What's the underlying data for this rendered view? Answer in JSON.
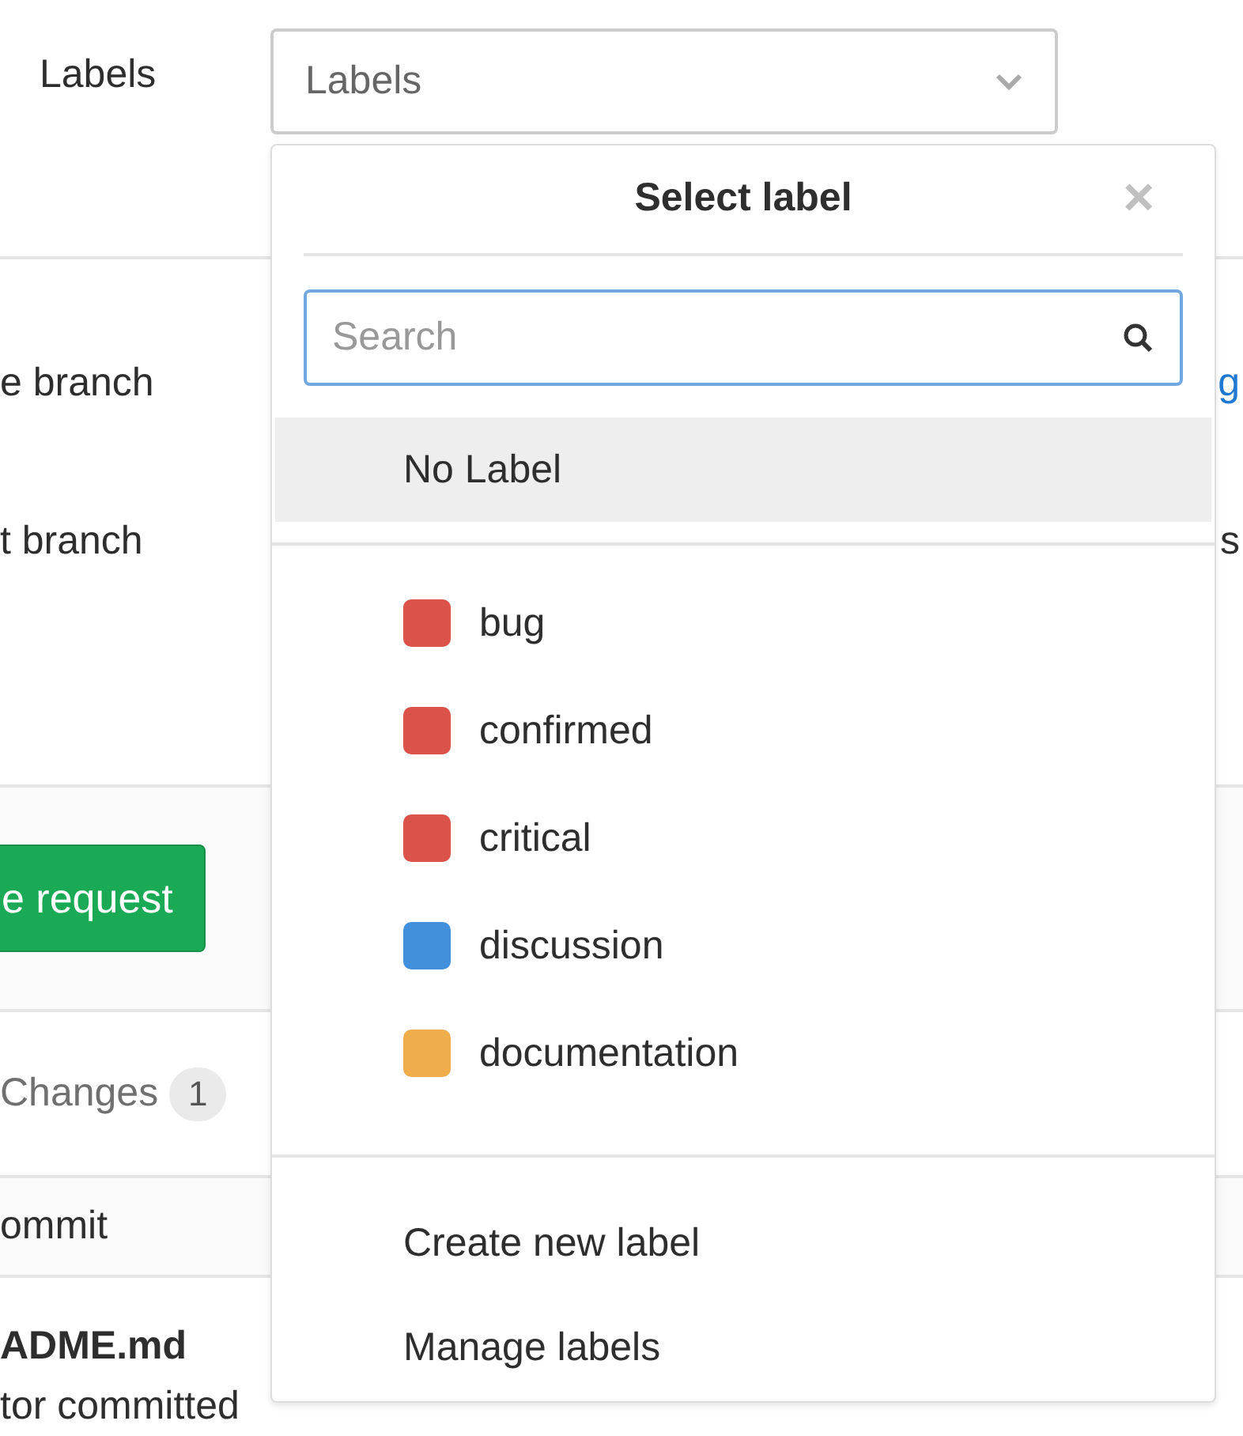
{
  "labels_field": {
    "label": "Labels",
    "placeholder": "Labels"
  },
  "branches": [
    "e branch",
    "t branch"
  ],
  "edge_texts": [
    {
      "text": "g",
      "kind": "link"
    },
    {
      "text": "s",
      "kind": "text"
    }
  ],
  "submit_button": "e request",
  "tabs": [
    {
      "label": "Changes",
      "count": "1",
      "selected": false
    }
  ],
  "commit_header": "ommit",
  "file": {
    "name": "ADME.md",
    "meta": "tor committed"
  },
  "dropdown": {
    "title": "Select label",
    "close": "×",
    "search": {
      "placeholder": "Search"
    },
    "no_label": {
      "text": "No Label",
      "selected": true
    },
    "labels": [
      {
        "name": "bug",
        "color": "#db524b"
      },
      {
        "name": "confirmed",
        "color": "#db524b"
      },
      {
        "name": "critical",
        "color": "#db524b"
      },
      {
        "name": "discussion",
        "color": "#428fdc"
      },
      {
        "name": "documentation",
        "color": "#f0ad4e"
      }
    ],
    "footer": [
      "Create new label",
      "Manage labels"
    ]
  }
}
